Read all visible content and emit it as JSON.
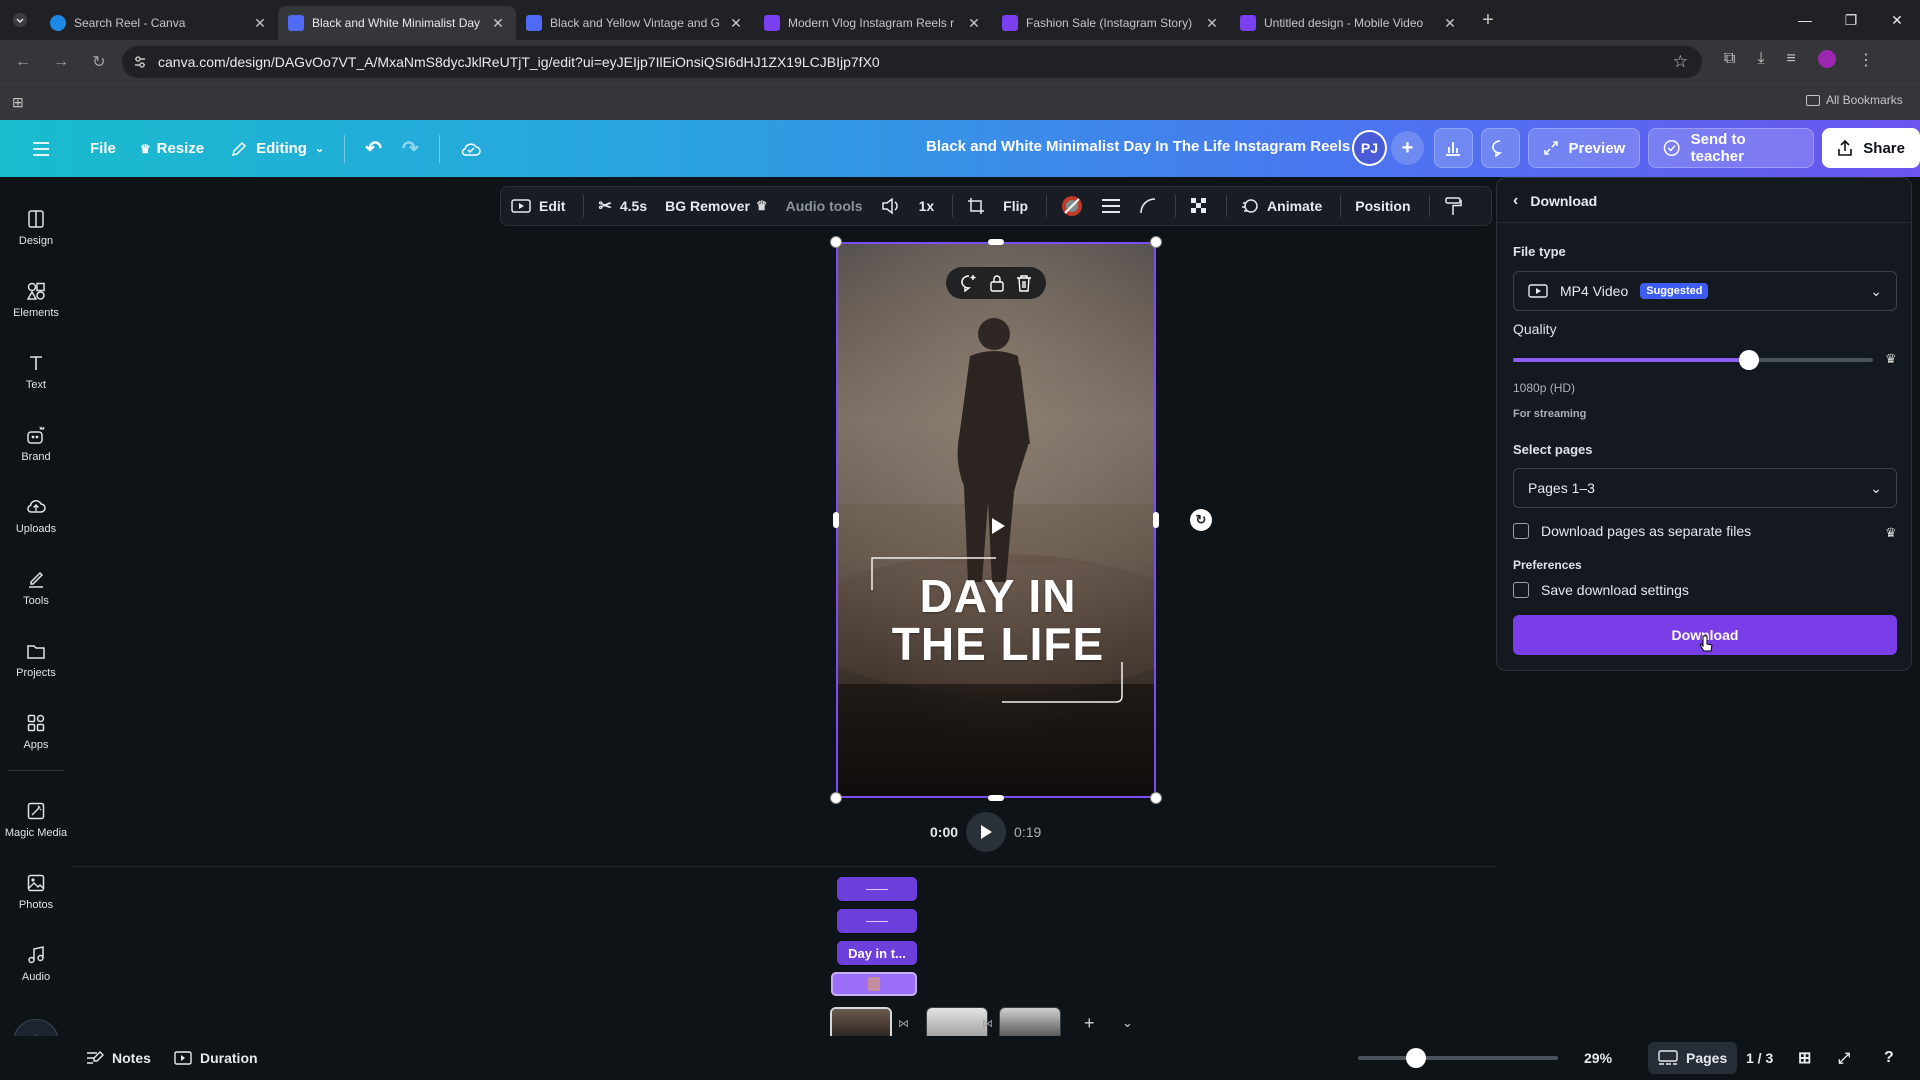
{
  "browser": {
    "tabs": [
      {
        "title": "Search Reel - Canva",
        "active": false,
        "favicon_color": "#1e88e5"
      },
      {
        "title": "Black and White Minimalist Day",
        "active": true,
        "favicon_color": "#4f6bf5"
      },
      {
        "title": "Black and Yellow Vintage and G",
        "active": false,
        "favicon_color": "#4f6bf5"
      },
      {
        "title": "Modern Vlog Instagram Reels r",
        "active": false,
        "favicon_color": "#7b3ff2"
      },
      {
        "title": "Fashion Sale (Instagram Story)",
        "active": false,
        "favicon_color": "#7b3ff2"
      },
      {
        "title": "Untitled design - Mobile Video",
        "active": false,
        "favicon_color": "#7b3ff2"
      }
    ],
    "url": "canva.com/design/DAGvOo7VT_A/MxaNmS8dycJklReUTjT_ig/edit?ui=eyJEIjp7IlEiOnsiQSI6dHJ1ZX19LCJBIjp7fX0",
    "bookmarks_label": "All Bookmarks"
  },
  "header": {
    "file_label": "File",
    "resize_label": "Resize",
    "editing_label": "Editing",
    "design_title": "Black and White Minimalist Day In The Life Instagram Reels",
    "avatar_initials": "PJ",
    "preview_label": "Preview",
    "send_label": "Send to teacher",
    "share_label": "Share"
  },
  "sidebar": {
    "items": [
      {
        "label": "Design",
        "icon": "design-icon"
      },
      {
        "label": "Elements",
        "icon": "elements-icon"
      },
      {
        "label": "Text",
        "icon": "text-icon"
      },
      {
        "label": "Brand",
        "icon": "brand-icon"
      },
      {
        "label": "Uploads",
        "icon": "uploads-icon"
      },
      {
        "label": "Tools",
        "icon": "tools-icon"
      },
      {
        "label": "Projects",
        "icon": "projects-icon"
      },
      {
        "label": "Apps",
        "icon": "apps-icon"
      },
      {
        "label": "Magic Media",
        "icon": "magic-media-icon"
      },
      {
        "label": "Photos",
        "icon": "photos-icon"
      },
      {
        "label": "Audio",
        "icon": "audio-icon"
      }
    ]
  },
  "toolbar": {
    "edit_label": "Edit",
    "duration_label": "4.5s",
    "bg_remover_label": "BG Remover",
    "audio_tools_label": "Audio tools",
    "speed_label": "1x",
    "flip_label": "Flip",
    "animate_label": "Animate",
    "position_label": "Position"
  },
  "canvas": {
    "headline_line1": "DAY IN",
    "headline_line2": "THE LIFE",
    "time_current": "0:00",
    "time_total": "0:19"
  },
  "timeline": {
    "text_track_label": "Day in t..."
  },
  "download_panel": {
    "title": "Download",
    "file_type_label": "File type",
    "file_type_value": "MP4 Video",
    "suggested_badge": "Suggested",
    "quality_label": "Quality",
    "quality_level": 0.655,
    "quality_value": "1080p (HD)",
    "quality_note": "For streaming",
    "select_pages_label": "Select pages",
    "pages_value": "Pages 1–3",
    "separate_files_label": "Download pages as separate files",
    "preferences_label": "Preferences",
    "save_settings_label": "Save download settings",
    "download_button": "Download"
  },
  "statusbar": {
    "notes_label": "Notes",
    "duration_label": "Duration",
    "zoom_value": "29%",
    "zoom_level": 0.29,
    "pages_label": "Pages",
    "page_counter": "1 / 3"
  },
  "colors": {
    "accent_purple": "#7a3ee8",
    "badge_blue": "#3d5cf2"
  }
}
